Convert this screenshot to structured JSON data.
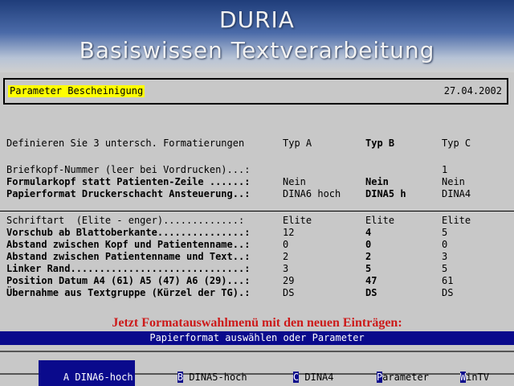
{
  "banner": {
    "title": "DURIA",
    "subtitle": "Basiswissen Textverarbeitung"
  },
  "header": {
    "title": "Parameter Bescheinigung",
    "date": "27.04.2002"
  },
  "columns": {
    "label": "Definieren Sie 3 untersch. Formatierungen",
    "a": "Typ A",
    "b": "Typ B",
    "c": "Typ C"
  },
  "rows1": [
    {
      "label": "Briefkopf-Nummer (leer bei Vordrucken)...:",
      "a": "",
      "b": "",
      "c": "1",
      "bold": false
    },
    {
      "label": "Formularkopf statt Patienten-Zeile ......:",
      "a": "Nein",
      "b": "Nein",
      "c": "Nein",
      "bold": true
    },
    {
      "label": "Papierformat Druckerschacht Ansteuerung..:",
      "a": "DINA6 hoch",
      "b": "DINA5 h",
      "c": "DINA4",
      "bold": true
    }
  ],
  "rows2": [
    {
      "label": "Schriftart  (Elite - enger).............:",
      "a": "Elite",
      "b": "Elite",
      "c": "Elite",
      "bold": false
    },
    {
      "label": "Vorschub ab Blattoberkante...............:",
      "a": "12",
      "b": "4",
      "c": "5",
      "bold": true
    },
    {
      "label": "Abstand zwischen Kopf und Patientenname..:",
      "a": "0",
      "b": "0",
      "c": "0",
      "bold": true
    },
    {
      "label": "Abstand zwischen Patientenname und Text..:",
      "a": "2",
      "b": "2",
      "c": "3",
      "bold": true
    },
    {
      "label": "Linker Rand..............................:",
      "a": "3",
      "b": "5",
      "c": "5",
      "bold": true
    },
    {
      "label": "Position Datum A4 (61) A5 (47) A6 (29)...:",
      "a": "29",
      "b": "47",
      "c": "61",
      "bold": true
    },
    {
      "label": "Übernahme aus Textgruppe (Kürzel der TG).:",
      "a": "DS",
      "b": "DS",
      "c": "DS",
      "bold": true
    }
  ],
  "notice": "Jetzt Formatauswahlmenü mit den neuen Einträgen:",
  "status": "Papierformat auswählen oder Parameter",
  "menu": [
    {
      "key": "A",
      "rest": " DINA6-hoch"
    },
    {
      "key": "B",
      "rest": " DINA5-hoch"
    },
    {
      "key": "C",
      "rest": " DINA4"
    },
    {
      "key": "P",
      "rest": "arameter"
    },
    {
      "key": "W",
      "rest": "inTV"
    }
  ],
  "colors": {
    "selection": "#0a0a8c",
    "highlight": "#ffff00",
    "notice": "#cc1a1a"
  }
}
